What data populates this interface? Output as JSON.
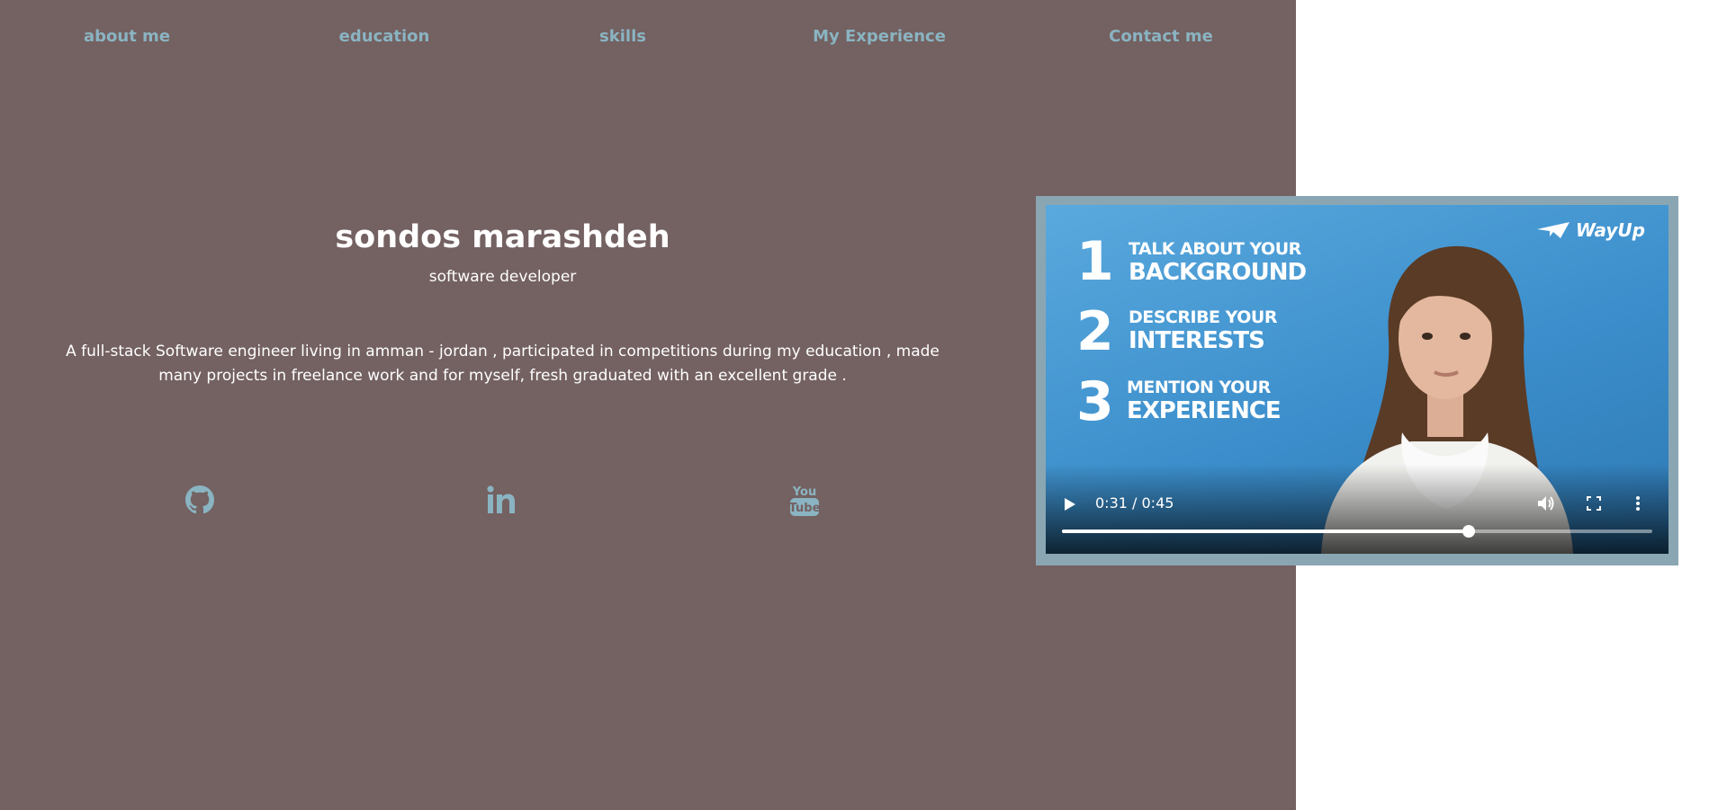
{
  "nav": {
    "items": [
      {
        "label": "about me"
      },
      {
        "label": "education"
      },
      {
        "label": "skills"
      },
      {
        "label": "My Experience"
      },
      {
        "label": "Contact me"
      }
    ]
  },
  "hero": {
    "name": "sondos marashdeh",
    "role": "software developer",
    "bio": "A full-stack Software engineer living in amman - jordan , participated in competitions during my education , made many projects in freelance work and for myself, fresh graduated with an excellent grade ."
  },
  "social": {
    "icons": [
      "github-icon",
      "linkedin-icon",
      "youtube-icon"
    ],
    "color": "#8ab4c2"
  },
  "video": {
    "brand": "WayUp",
    "steps": [
      {
        "number": "1",
        "line1": "TALK ABOUT YOUR",
        "line2": "BACKGROUND"
      },
      {
        "number": "2",
        "line1": "DESCRIBE YOUR",
        "line2": "INTERESTS"
      },
      {
        "number": "3",
        "line1": "MENTION YOUR",
        "line2": "EXPERIENCE"
      }
    ],
    "time_display": "0:31 / 0:45",
    "progress": 0.689
  },
  "colors": {
    "panel_bg": "#746161",
    "nav_link": "#8ab4c2",
    "video_border": "#8aa6b2"
  }
}
